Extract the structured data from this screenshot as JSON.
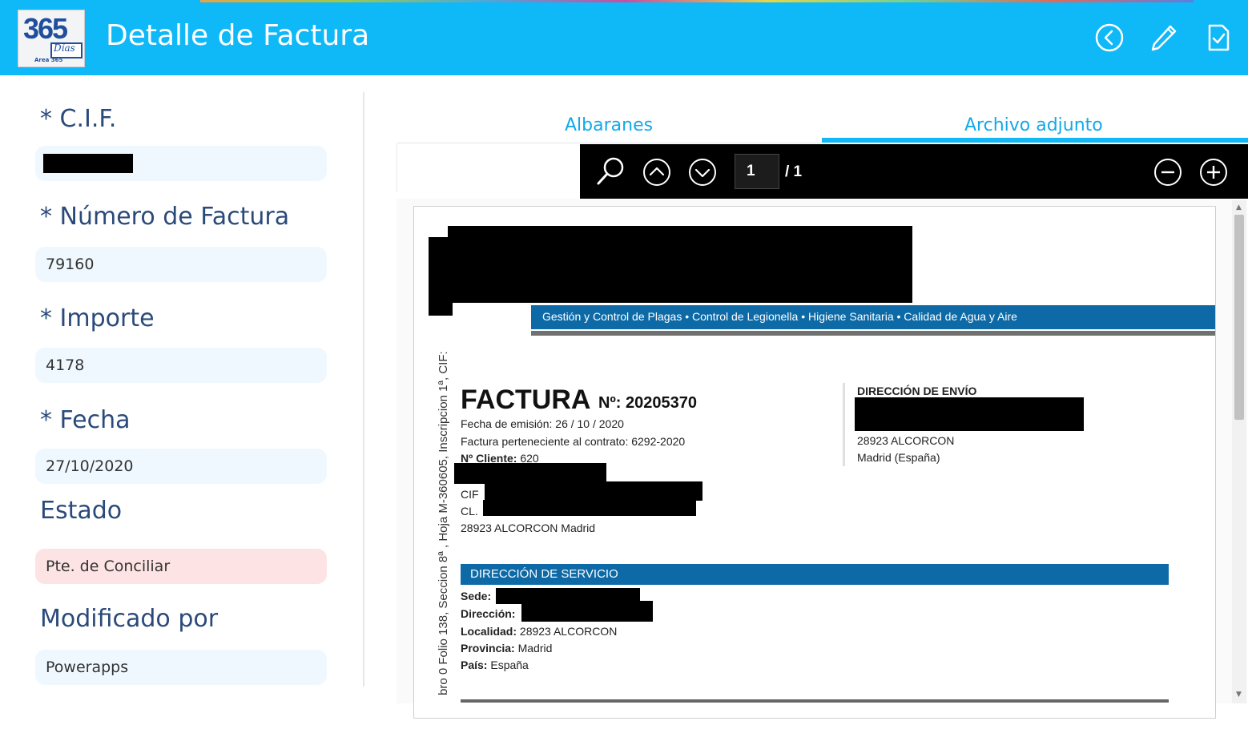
{
  "header": {
    "title": "Detalle de Factura",
    "logo_number": "365",
    "logo_word": "Días",
    "logo_area": "Area 365",
    "back_icon": "chevron-left-circle-icon",
    "edit_icon": "pencil-icon",
    "submit_icon": "check-document-icon"
  },
  "form": {
    "cif_label": "* C.I.F.",
    "numero_label": "* Número de Factura",
    "numero_value": "79160",
    "importe_label": "* Importe",
    "importe_value": "4178",
    "fecha_label": "* Fecha",
    "fecha_value": "27/10/2020",
    "estado_label": "Estado",
    "estado_value": "Pte. de Conciliar",
    "modificado_label": "Modificado por",
    "modificado_value": "Powerapps"
  },
  "tabs": [
    {
      "label": "Albaranes",
      "active": false
    },
    {
      "label": "Archivo adjunto",
      "active": true
    }
  ],
  "pdf_toolbar": {
    "current_page": "1",
    "total_pages": "/ 1"
  },
  "document": {
    "side_text": "bro 0 Folio 138, Seccion 8ª , Hoja M-360605, Inscripcion 1ª, CIF:",
    "services_band": "Gestión y Control de Plagas • Control de Legionella • Higiene Sanitaria • Calidad de Agua y Aire",
    "title": "FACTURA",
    "number": "Nº: 20205370",
    "emision": "Fecha de emisión: 26 / 10 / 2020",
    "contrato": "Factura perteneciente al contrato: 6292-2020",
    "cliente_label": "Nº Cliente:",
    "cliente_value": "620",
    "cif_label": "CIF",
    "cl_label": "CL.",
    "client_city": "28923 ALCORCON Madrid",
    "envio_title": "DIRECCIÓN DE ENVÍO",
    "envio_city": "28923 ALCORCON",
    "envio_region": "Madrid (España)",
    "servicio_title": "DIRECCIÓN DE SERVICIO",
    "sede_label": "Sede:",
    "direccion_label": "Dirección:",
    "localidad_label": "Localidad:",
    "localidad_value": "28923 ALCORCON",
    "provincia_label": "Provincia:",
    "provincia_value": "Madrid",
    "pais_label": "País:",
    "pais_value": "España"
  }
}
